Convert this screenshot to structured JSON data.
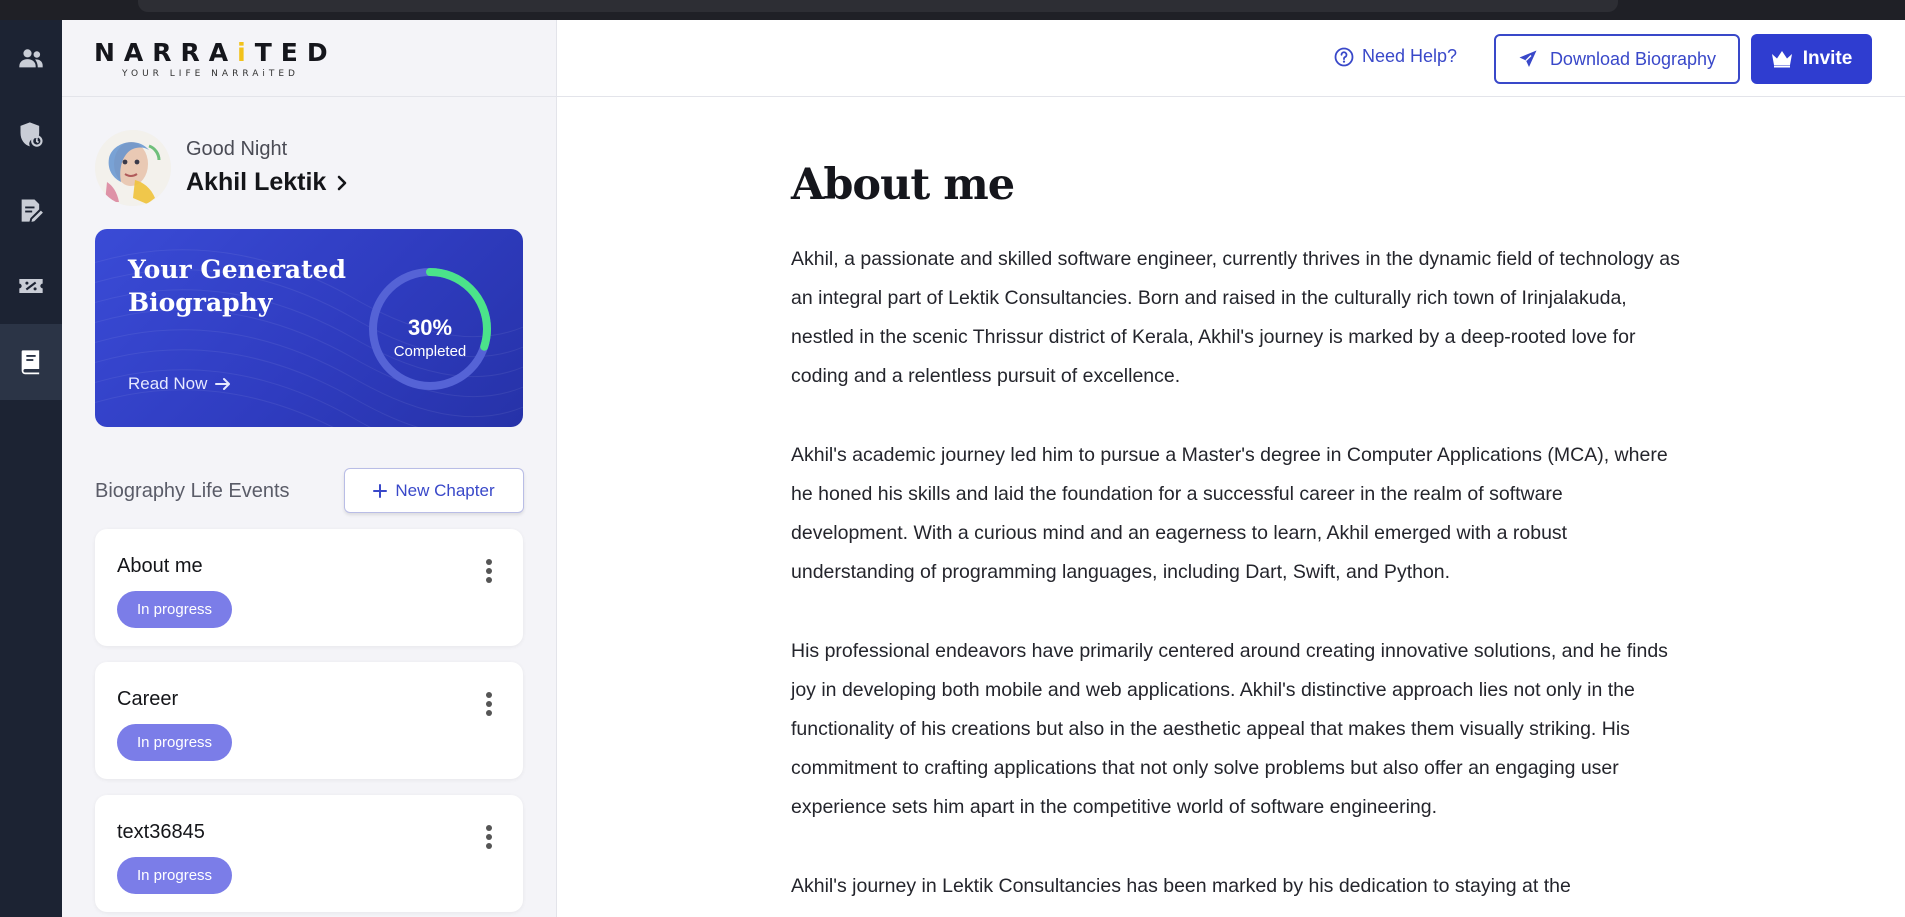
{
  "brand": {
    "logo_prefix": "NARRA",
    "logo_ai": "i",
    "logo_suffix": "TED",
    "tagline": "YOUR LIFE NARRAiTED"
  },
  "rail": {
    "items": [
      {
        "icon": "people-icon"
      },
      {
        "icon": "shield-icon"
      },
      {
        "icon": "document-edit-icon"
      },
      {
        "icon": "discount-ticket-icon"
      },
      {
        "icon": "book-icon"
      }
    ],
    "active_index": 4
  },
  "profile": {
    "greeting": "Good Night",
    "name": "Akhil Lektik"
  },
  "biography_card": {
    "title": "Your Generated Biography",
    "read_now": "Read Now",
    "progress_percent": 30,
    "progress_label": "30%",
    "progress_caption": "Completed"
  },
  "events": {
    "heading": "Biography Life Events",
    "new_chapter_label": "New Chapter",
    "items": [
      {
        "title": "About me",
        "status": "In progress"
      },
      {
        "title": "Career",
        "status": "In progress"
      },
      {
        "title": "text36845",
        "status": "In progress"
      }
    ]
  },
  "topbar": {
    "need_help": "Need Help?",
    "download": "Download Biography",
    "invite": "Invite"
  },
  "article": {
    "title": "About me",
    "paragraphs": [
      "Akhil, a passionate and skilled software engineer, currently thrives in the dynamic field of technology as an integral part of Lektik Consultancies. Born and raised in the culturally rich town of Irinjalakuda, nestled in the scenic Thrissur district of Kerala, Akhil's journey is marked by a deep-rooted love for coding and a relentless pursuit of excellence.",
      "Akhil's academic journey led him to pursue a Master's degree in Computer Applications (MCA), where he honed his skills and laid the foundation for a successful career in the realm of software development. With a curious mind and an eagerness to learn, Akhil emerged with a robust understanding of programming languages, including Dart, Swift, and Python.",
      "His professional endeavors have primarily centered around creating innovative solutions, and he finds joy in developing both mobile and web applications. Akhil's distinctive approach lies not only in the functionality of his creations but also in the aesthetic appeal that makes them visually striking. His commitment to crafting applications that not only solve problems but also offer an engaging user experience sets him apart in the competitive world of software engineering.",
      "Akhil's journey in Lektik Consultancies has been marked by his dedication to staying at the"
    ]
  },
  "colors": {
    "accent": "#3948c9",
    "badge": "#7b7de8",
    "progress": "#4be38a",
    "rail_bg": "#1c2333"
  }
}
